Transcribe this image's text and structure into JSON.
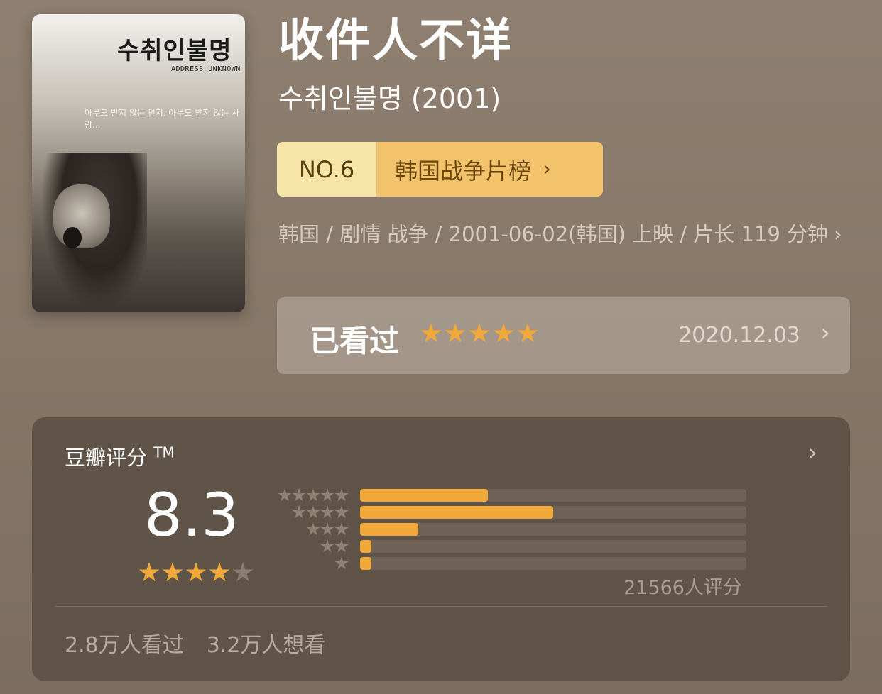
{
  "poster": {
    "title_korean": "수취인불명",
    "subtitle": "ADDRESS UNKNOWN",
    "tagline": "아무도 받지 않는 편지, 아무도 받지 않는 사랑..."
  },
  "movie": {
    "title": "收件人不详",
    "original_title": "수취인불명 (2001)"
  },
  "rank": {
    "number": "NO.6",
    "list_name": "韩国战争片榜",
    "chevron": "chevron-right-icon"
  },
  "meta": {
    "text": "韩国 / 剧情 战争 / 2001-06-02(韩国) 上映 / 片长 119 分钟",
    "chevron_glyph": "›"
  },
  "watched": {
    "label": "已看过",
    "stars": 5,
    "date": "2020.12.03",
    "chevron_glyph": "›"
  },
  "rating": {
    "heading": "豆瓣评分",
    "tm": "TM",
    "score": "8.3",
    "score_stars": 4,
    "chevron_glyph": "›",
    "distribution": [
      {
        "stars": 5,
        "fraction": 0.33
      },
      {
        "stars": 4,
        "fraction": 0.5
      },
      {
        "stars": 3,
        "fraction": 0.15
      },
      {
        "stars": 2,
        "fraction": 0.03
      },
      {
        "stars": 1,
        "fraction": 0.03
      }
    ],
    "count_text": "21566人评分",
    "watched_text": "2.8万人看过",
    "want_text": "3.2万人想看"
  },
  "colors": {
    "accent_star": "#f0a83a",
    "rank_number_bg": "#f7e4a8",
    "rank_list_bg": "#f3c36c"
  }
}
